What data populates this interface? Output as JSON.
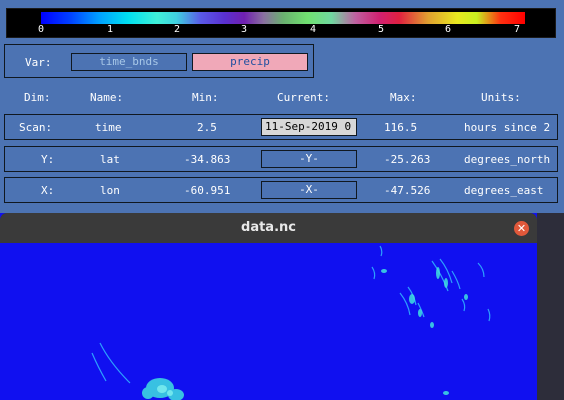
{
  "colorbar": {
    "ticks": [
      "0",
      "1",
      "2",
      "3",
      "4",
      "5",
      "6",
      "7"
    ]
  },
  "var": {
    "label": "Var:",
    "options": [
      "time_bnds",
      "precip"
    ],
    "selected": "precip"
  },
  "headers": {
    "dim": "Dim:",
    "name": "Name:",
    "min": "Min:",
    "current": "Current:",
    "max": "Max:",
    "units": "Units:"
  },
  "rows": [
    {
      "dim": "Scan:",
      "name": "time",
      "min": "2.5",
      "current": "11-Sep-2019 0",
      "max": "116.5",
      "units": "hours since 2"
    },
    {
      "dim": "Y:",
      "name": "lat",
      "min": "-34.863",
      "current": "-Y-",
      "max": "-25.263",
      "units": "degrees_north"
    },
    {
      "dim": "X:",
      "name": "lon",
      "min": "-60.951",
      "current": "-X-",
      "max": "-47.526",
      "units": "degrees_east"
    }
  ],
  "window": {
    "title": "data.nc",
    "close": "✕"
  },
  "colors": {
    "panel": "#4c73b3",
    "plot_background": "#1010f0",
    "selected_var": "#f0a8b8"
  }
}
